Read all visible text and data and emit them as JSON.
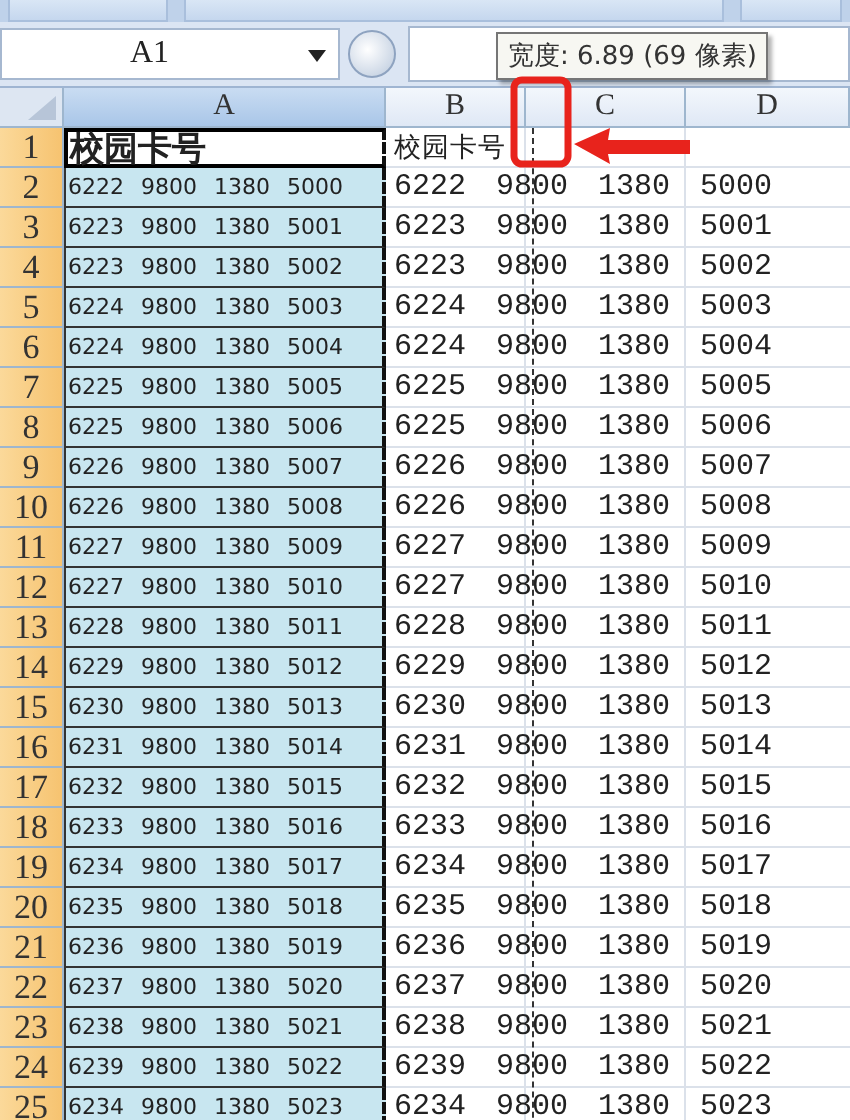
{
  "name_box": "A1",
  "tooltip": "宽度: 6.89 (69 像素)",
  "columns": [
    {
      "label": "A",
      "selected": true
    },
    {
      "label": "B",
      "selected": false
    },
    {
      "label": "C",
      "selected": false
    },
    {
      "label": "D",
      "selected": false
    }
  ],
  "rows": [
    {
      "number": "1",
      "kind": "title",
      "a": "校园卡号",
      "b": "校园卡号"
    },
    {
      "number": "2",
      "kind": "data",
      "a": "6222 9800 1380 5000",
      "b": "6222 9800 1380 5000"
    },
    {
      "number": "3",
      "kind": "data",
      "a": "6223 9800 1380 5001",
      "b": "6223 9800 1380 5001"
    },
    {
      "number": "4",
      "kind": "data",
      "a": "6223 9800 1380 5002",
      "b": "6223 9800 1380 5002"
    },
    {
      "number": "5",
      "kind": "data",
      "a": "6224 9800 1380 5003",
      "b": "6224 9800 1380 5003"
    },
    {
      "number": "6",
      "kind": "data",
      "a": "6224 9800 1380 5004",
      "b": "6224 9800 1380 5004"
    },
    {
      "number": "7",
      "kind": "data",
      "a": "6225 9800 1380 5005",
      "b": "6225 9800 1380 5005"
    },
    {
      "number": "8",
      "kind": "data",
      "a": "6225 9800 1380 5006",
      "b": "6225 9800 1380 5006"
    },
    {
      "number": "9",
      "kind": "data",
      "a": "6226 9800 1380 5007",
      "b": "6226 9800 1380 5007"
    },
    {
      "number": "10",
      "kind": "data",
      "a": "6226 9800 1380 5008",
      "b": "6226 9800 1380 5008"
    },
    {
      "number": "11",
      "kind": "data",
      "a": "6227 9800 1380 5009",
      "b": "6227 9800 1380 5009"
    },
    {
      "number": "12",
      "kind": "data",
      "a": "6227 9800 1380 5010",
      "b": "6227 9800 1380 5010"
    },
    {
      "number": "13",
      "kind": "data",
      "a": "6228 9800 1380 5011",
      "b": "6228 9800 1380 5011"
    },
    {
      "number": "14",
      "kind": "data",
      "a": "6229 9800 1380 5012",
      "b": "6229 9800 1380 5012"
    },
    {
      "number": "15",
      "kind": "data",
      "a": "6230 9800 1380 5013",
      "b": "6230 9800 1380 5013"
    },
    {
      "number": "16",
      "kind": "data",
      "a": "6231 9800 1380 5014",
      "b": "6231 9800 1380 5014"
    },
    {
      "number": "17",
      "kind": "data",
      "a": "6232 9800 1380 5015",
      "b": "6232 9800 1380 5015"
    },
    {
      "number": "18",
      "kind": "data",
      "a": "6233 9800 1380 5016",
      "b": "6233 9800 1380 5016"
    },
    {
      "number": "19",
      "kind": "data",
      "a": "6234 9800 1380 5017",
      "b": "6234 9800 1380 5017"
    },
    {
      "number": "20",
      "kind": "data",
      "a": "6235 9800 1380 5018",
      "b": "6235 9800 1380 5018"
    },
    {
      "number": "21",
      "kind": "data",
      "a": "6236 9800 1380 5019",
      "b": "6236 9800 1380 5019"
    },
    {
      "number": "22",
      "kind": "data",
      "a": "6237 9800 1380 5020",
      "b": "6237 9800 1380 5020"
    },
    {
      "number": "23",
      "kind": "data",
      "a": "6238 9800 1380 5021",
      "b": "6238 9800 1380 5021"
    },
    {
      "number": "24",
      "kind": "data",
      "a": "6239 9800 1380 5022",
      "b": "6239 9800 1380 5022"
    },
    {
      "number": "25",
      "kind": "data",
      "a": "6234 9800 1380 5023",
      "b": "6234 9800 1380 5023"
    }
  ]
}
